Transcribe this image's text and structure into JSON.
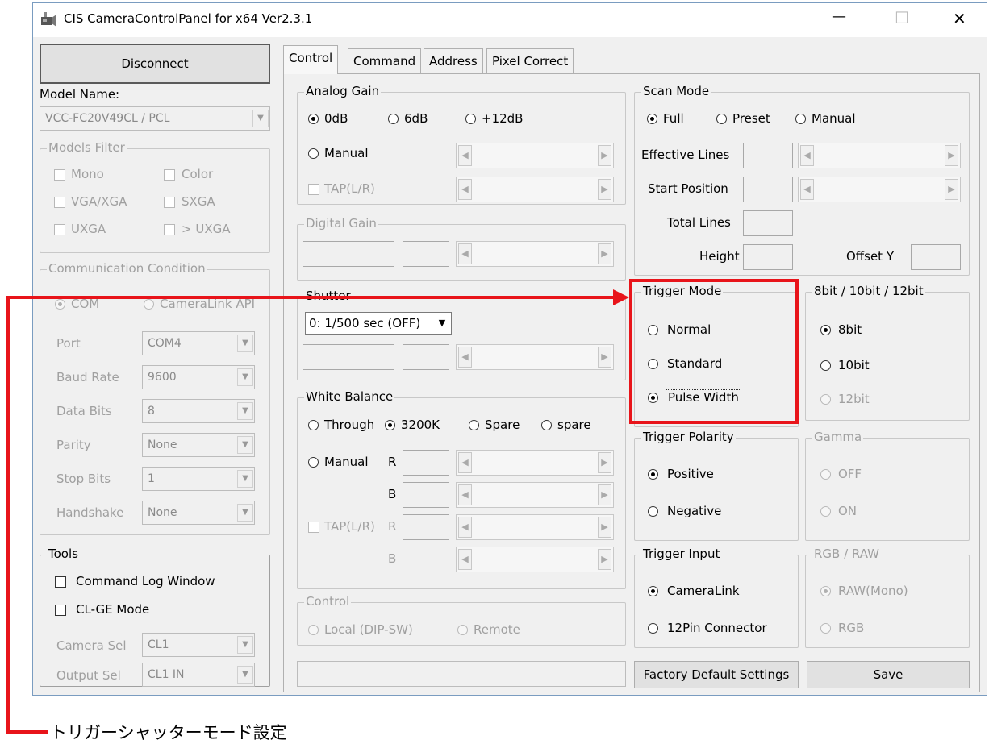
{
  "window": {
    "title": "CIS CameraControlPanel  for x64  Ver2.3.1",
    "min_glyph": "—",
    "max_glyph": "☐",
    "close_glyph": "✕"
  },
  "left": {
    "disconnect": "Disconnect",
    "model_name_label": "Model Name:",
    "model_value": "VCC-FC20V49CL / PCL",
    "models_filter": {
      "title": "Models Filter",
      "mono": "Mono",
      "color": "Color",
      "vga": "VGA/XGA",
      "sxga": "SXGA",
      "uxga": "UXGA",
      "gt_uxga": "> UXGA"
    },
    "comm": {
      "title": "Communication Condition",
      "com": "COM",
      "cameralink_api": "CameraLink API",
      "rows": [
        {
          "label": "Port",
          "value": "COM4"
        },
        {
          "label": "Baud Rate",
          "value": "9600"
        },
        {
          "label": "Data Bits",
          "value": "8"
        },
        {
          "label": "Parity",
          "value": "None"
        },
        {
          "label": "Stop Bits",
          "value": "1"
        },
        {
          "label": "Handshake",
          "value": "None"
        }
      ]
    },
    "tools": {
      "title": "Tools",
      "command_log": "Command Log Window",
      "clge": "CL-GE Mode",
      "camera_sel_label": "Camera Sel",
      "camera_sel_value": "CL1",
      "output_sel_label": "Output Sel",
      "output_sel_value": "CL1 IN"
    }
  },
  "tabs": [
    "Control",
    "Command",
    "Address",
    "Pixel Correct"
  ],
  "analog_gain": {
    "title": "Analog Gain",
    "r0": "0dB",
    "r6": "6dB",
    "r12": "+12dB",
    "manual": "Manual",
    "tap": "TAP(L/R)"
  },
  "digital_gain": {
    "title": "Digital Gain"
  },
  "shutter": {
    "title": "Shutter",
    "value": "0: 1/500 sec (OFF)"
  },
  "white_balance": {
    "title": "White Balance",
    "through": "Through",
    "k3200": "3200K",
    "spare1": "Spare",
    "spare2": "spare",
    "manual": "Manual",
    "tap": "TAP(L/R)",
    "r": "R",
    "b": "B"
  },
  "control_group": {
    "title": "Control",
    "local": "Local (DIP-SW)",
    "remote": "Remote"
  },
  "scan_mode": {
    "title": "Scan Mode",
    "full": "Full",
    "preset": "Preset",
    "manual": "Manual",
    "effective_lines": "Effective Lines",
    "start_position": "Start Position",
    "total_lines": "Total Lines",
    "height": "Height",
    "offset_y": "Offset Y"
  },
  "trigger_mode": {
    "title": "Trigger Mode",
    "normal": "Normal",
    "standard": "Standard",
    "pulse_width": "Pulse Width"
  },
  "bit_depth": {
    "title": "8bit / 10bit / 12bit",
    "b8": "8bit",
    "b10": "10bit",
    "b12": "12bit"
  },
  "trigger_polarity": {
    "title": "Trigger Polarity",
    "positive": "Positive",
    "negative": "Negative"
  },
  "gamma": {
    "title": "Gamma",
    "off": "OFF",
    "on": "ON"
  },
  "trigger_input": {
    "title": "Trigger Input",
    "cameralink": "CameraLink",
    "pin12": "12Pin Connector"
  },
  "rgb_raw": {
    "title": "RGB / RAW",
    "raw": "RAW(Mono)",
    "rgb": "RGB"
  },
  "buttons": {
    "factory": "Factory Default Settings",
    "save": "Save"
  },
  "annotation": {
    "text": "トリガーシャッターモード設定",
    "color": "#e8141a"
  },
  "colors": {
    "highlight": "#e8141a",
    "window_bg": "#f0f0f0",
    "window_border": "#7a9cc0"
  }
}
